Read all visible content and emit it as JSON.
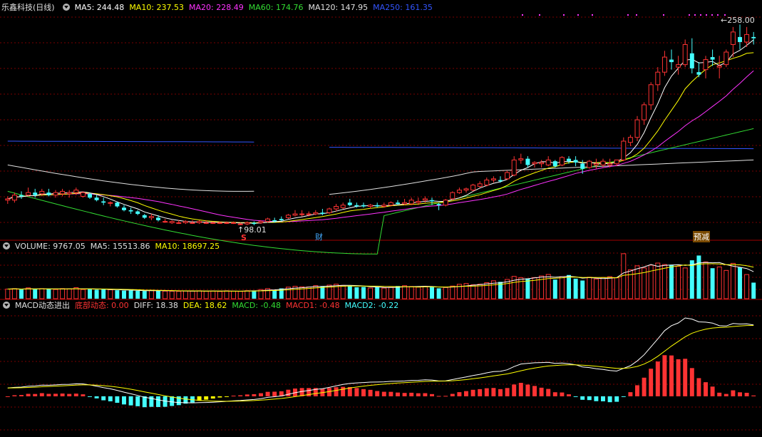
{
  "stock_title": "乐鑫科技(日线)",
  "price_ma": [
    {
      "label": "MA5: 244.48",
      "color": "#ffffff"
    },
    {
      "label": "MA10: 237.53",
      "color": "#ffff00"
    },
    {
      "label": "MA20: 228.49",
      "color": "#ff33ff"
    },
    {
      "label": "MA60: 174.76",
      "color": "#33dd33"
    },
    {
      "label": "MA120: 147.95",
      "color": "#e0e0e0"
    },
    {
      "label": "MA250: 161.35",
      "color": "#3355ff"
    }
  ],
  "volume_header": [
    {
      "label": "VOLUME: 9767.05",
      "color": "#e0e0e0"
    },
    {
      "label": "MA5: 15513.86",
      "color": "#e0e0e0"
    },
    {
      "label": "MA10: 18697.25",
      "color": "#ffff00"
    }
  ],
  "macd_header": [
    {
      "label": "MACD动态进出",
      "color": "#e0e0e0"
    },
    {
      "label": "底部动态: 0.00",
      "color": "#ff3333"
    },
    {
      "label": "DIFF: 18.38",
      "color": "#e0e0e0"
    },
    {
      "label": "DEA: 18.62",
      "color": "#ffff00"
    },
    {
      "label": "MACD: -0.48",
      "color": "#33dd33"
    },
    {
      "label": "MACD1: -0.48",
      "color": "#ff3333"
    },
    {
      "label": "MACD2: -0.22",
      "color": "#44ffff"
    }
  ],
  "annotations": {
    "high_label": "258.00",
    "low_label": "98.01",
    "marker_s": "S",
    "marker_cai": "财",
    "marker_yujian": "预减"
  },
  "colors": {
    "up": "#ff3333",
    "down": "#44ffff",
    "grid": "#7a0000",
    "ma5": "#ffffff",
    "ma10": "#ffff00",
    "ma20": "#ff33ff",
    "ma60": "#33dd33",
    "ma120": "#e0e0e0",
    "ma250": "#3355ff"
  },
  "chart_data": [
    {
      "type": "candlestick",
      "title": "乐鑫科技(日线)",
      "ylim": [
        90,
        265
      ],
      "ohlc": [
        [
          118,
          121,
          115,
          119
        ],
        [
          118,
          124,
          116,
          122
        ],
        [
          122,
          125,
          119,
          121
        ],
        [
          122,
          128,
          121,
          124
        ],
        [
          124,
          127,
          120,
          122
        ],
        [
          123,
          127,
          121,
          125
        ],
        [
          124,
          127,
          121,
          122
        ],
        [
          122,
          126,
          120,
          124
        ],
        [
          123,
          127,
          121,
          125
        ],
        [
          123,
          126,
          120,
          124
        ],
        [
          124,
          128,
          122,
          126
        ],
        [
          121,
          125,
          120,
          124
        ],
        [
          123,
          124,
          119,
          120
        ],
        [
          120,
          122,
          117,
          118
        ],
        [
          117,
          120,
          114,
          116
        ],
        [
          116,
          117,
          113,
          116
        ],
        [
          116,
          117,
          112,
          113
        ],
        [
          112,
          114,
          109,
          110
        ],
        [
          110,
          112,
          107,
          109
        ],
        [
          109,
          110,
          106,
          107
        ],
        [
          106,
          107,
          103,
          104
        ],
        [
          104,
          107,
          102,
          105
        ],
        [
          104,
          106,
          101,
          102
        ],
        [
          101,
          103,
          100,
          101
        ],
        [
          100,
          102,
          99,
          101
        ],
        [
          100,
          102,
          99,
          100
        ],
        [
          100,
          102,
          99,
          101
        ],
        [
          100,
          102,
          99,
          100
        ],
        [
          100,
          102,
          99,
          101
        ],
        [
          100,
          102,
          99,
          100
        ],
        [
          100,
          101,
          99,
          100
        ],
        [
          100,
          101,
          99,
          100
        ],
        [
          100,
          101,
          99,
          100
        ],
        [
          100,
          101,
          99,
          100
        ],
        [
          99,
          100,
          98,
          99
        ],
        [
          99,
          101,
          98,
          100
        ],
        [
          100,
          101,
          98,
          99
        ],
        [
          100,
          102,
          99,
          101
        ],
        [
          101,
          104,
          100,
          103
        ],
        [
          102,
          104,
          100,
          101
        ],
        [
          103,
          105,
          101,
          102
        ],
        [
          104,
          107,
          103,
          106
        ],
        [
          106,
          110,
          105,
          107
        ],
        [
          107,
          110,
          105,
          107
        ],
        [
          107,
          109,
          105,
          107
        ],
        [
          107,
          110,
          106,
          108
        ],
        [
          108,
          111,
          106,
          107
        ],
        [
          108,
          112,
          107,
          111
        ],
        [
          111,
          115,
          109,
          113
        ],
        [
          112,
          116,
          111,
          114
        ],
        [
          116,
          119,
          113,
          114
        ],
        [
          114,
          116,
          112,
          113
        ],
        [
          114,
          116,
          112,
          113
        ],
        [
          113,
          115,
          111,
          114
        ],
        [
          114,
          116,
          112,
          113
        ],
        [
          113,
          116,
          112,
          114
        ],
        [
          114,
          117,
          113,
          116
        ],
        [
          116,
          118,
          114,
          115
        ],
        [
          115,
          119,
          114,
          116
        ],
        [
          115,
          120,
          114,
          118
        ],
        [
          116,
          120,
          114,
          117
        ],
        [
          118,
          121,
          116,
          119
        ],
        [
          118,
          120,
          114,
          117
        ],
        [
          115,
          116,
          110,
          114
        ],
        [
          114,
          119,
          113,
          118
        ],
        [
          119,
          125,
          118,
          124
        ],
        [
          124,
          128,
          123,
          126
        ],
        [
          126,
          128,
          124,
          127
        ],
        [
          126,
          131,
          125,
          130
        ],
        [
          129,
          133,
          128,
          131
        ],
        [
          130,
          136,
          129,
          134
        ],
        [
          134,
          137,
          132,
          135
        ],
        [
          134,
          137,
          132,
          133
        ],
        [
          135,
          141,
          134,
          140
        ],
        [
          138,
          153,
          137,
          150
        ],
        [
          150,
          155,
          147,
          151
        ],
        [
          151,
          153,
          144,
          146
        ],
        [
          147,
          149,
          144,
          148
        ],
        [
          147,
          150,
          144,
          148
        ],
        [
          146,
          153,
          145,
          150
        ],
        [
          149,
          150,
          144,
          145
        ],
        [
          146,
          153,
          145,
          152
        ],
        [
          151,
          153,
          147,
          149
        ],
        [
          150,
          153,
          145,
          148
        ],
        [
          147,
          150,
          139,
          143
        ],
        [
          144,
          150,
          143,
          149
        ],
        [
          146,
          151,
          143,
          147
        ],
        [
          146,
          151,
          144,
          149
        ],
        [
          146,
          151,
          144,
          147
        ],
        [
          147,
          150,
          145,
          150
        ],
        [
          150,
          168,
          149,
          165
        ],
        [
          164,
          170,
          161,
          168
        ],
        [
          168,
          185,
          165,
          182
        ],
        [
          182,
          196,
          178,
          194
        ],
        [
          194,
          212,
          190,
          210
        ],
        [
          210,
          224,
          205,
          220
        ],
        [
          220,
          237,
          217,
          232
        ],
        [
          230,
          238,
          222,
          228
        ],
        [
          224,
          233,
          218,
          226
        ],
        [
          226,
          246,
          224,
          242
        ],
        [
          235,
          247,
          219,
          223
        ],
        [
          220,
          228,
          216,
          218
        ],
        [
          222,
          233,
          215,
          230
        ],
        [
          232,
          238,
          225,
          230
        ],
        [
          224,
          233,
          215,
          225
        ],
        [
          226,
          238,
          224,
          236
        ],
        [
          242,
          256,
          232,
          252
        ],
        [
          248,
          258,
          238,
          244
        ],
        [
          244,
          256,
          240,
          250
        ],
        [
          248,
          252,
          242,
          247
        ]
      ],
      "ma_series": [
        {
          "name": "MA5",
          "values_at_end": 244.48
        },
        {
          "name": "MA10",
          "values_at_end": 237.53
        },
        {
          "name": "MA20",
          "values_at_end": 228.49
        },
        {
          "name": "MA60",
          "values_at_end": 174.76
        },
        {
          "name": "MA120",
          "values_at_end": 147.95
        },
        {
          "name": "MA250",
          "values_at_end": 161.35
        }
      ],
      "high_point": 258.0,
      "low_point": 98.01
    },
    {
      "type": "bar",
      "title": "VOLUME",
      "ylim": [
        0,
        52000
      ],
      "values": [
        10500,
        11000,
        10000,
        11800,
        10200,
        11000,
        10500,
        10000,
        11000,
        10800,
        12000,
        10000,
        10300,
        9800,
        10200,
        9800,
        9200,
        8800,
        9000,
        8600,
        8400,
        9200,
        8800,
        8300,
        8200,
        8000,
        8400,
        8200,
        8600,
        8100,
        8200,
        7900,
        8600,
        8200,
        8000,
        8700,
        9000,
        10000,
        11000,
        9600,
        11200,
        12600,
        13500,
        13000,
        12800,
        14200,
        13600,
        14800,
        15800,
        14500,
        13800,
        12500,
        12800,
        11600,
        12800,
        11600,
        12300,
        13800,
        14200,
        13300,
        12600,
        13500,
        12800,
        11300,
        12200,
        13800,
        15700,
        16500,
        15200,
        15800,
        17500,
        19500,
        18300,
        21000,
        24300,
        23000,
        22000,
        23000,
        24800,
        26400,
        20800,
        24000,
        25800,
        21800,
        19800,
        23400,
        21500,
        23100,
        24000,
        22800,
        49000,
        31500,
        35800,
        33500,
        36500,
        38800,
        37200,
        37000,
        35300,
        33500,
        41800,
        47000,
        40000,
        33200,
        34600,
        30800,
        38500,
        34000,
        26300,
        17500
      ],
      "ma5": 15513.86,
      "ma10": 18697.25
    },
    {
      "type": "macd",
      "title": "MACD动态进出",
      "ylim": [
        -14,
        30
      ],
      "diff_end": 18.38,
      "dea_end": 18.62,
      "macd_end": -0.48,
      "macd1_end": -0.48,
      "macd2_end": -0.22,
      "bottom_dynamic": 0.0
    }
  ]
}
